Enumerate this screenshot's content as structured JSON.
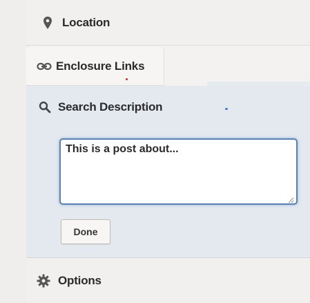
{
  "sidebar": {
    "location": {
      "label": "Location",
      "icon": "map-pin-icon"
    },
    "enclosure": {
      "label": "Enclosure Links",
      "icon": "link-icon"
    },
    "search": {
      "label": "Search Description",
      "icon": "search-icon",
      "textarea_value": "This is a post about...",
      "done_label": "Done"
    },
    "options": {
      "label": "Options",
      "icon": "gear-icon"
    }
  },
  "colors": {
    "focus_border": "#5b82b5",
    "active_bg": "#e3e9ef",
    "text": "#2a2a2a"
  }
}
